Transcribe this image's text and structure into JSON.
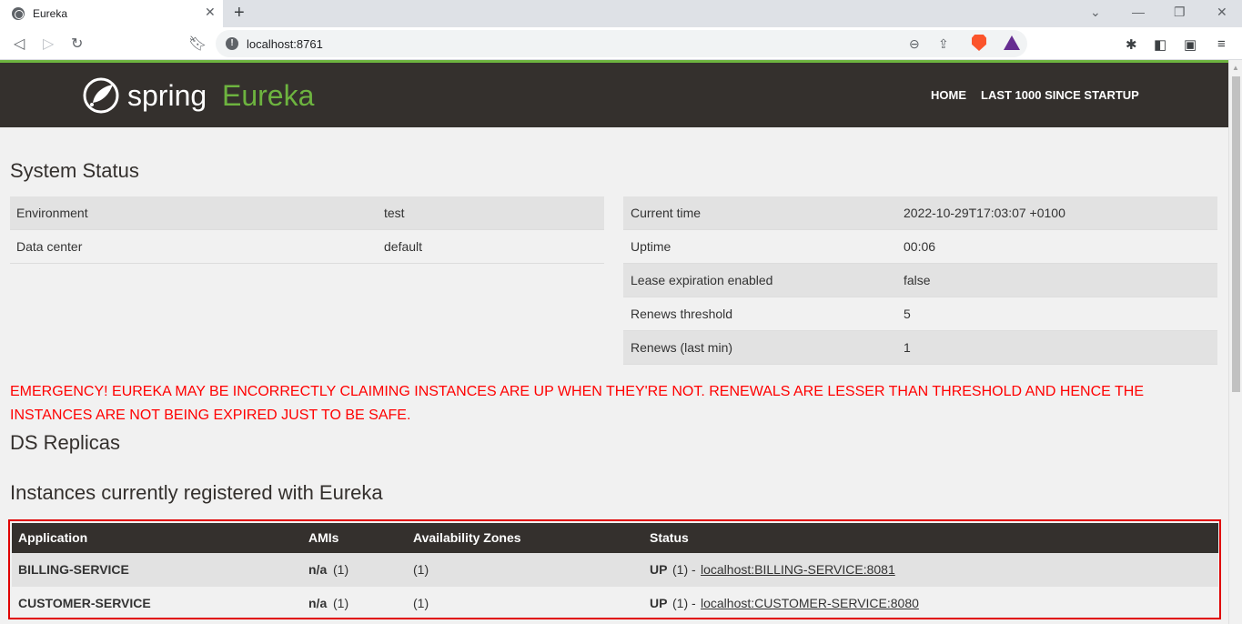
{
  "browser": {
    "tab_title": "Eureka",
    "tab_close": "✕",
    "new_tab": "+",
    "url": "localhost:8761",
    "window_controls": [
      "⌄",
      "—",
      "❐",
      "✕"
    ]
  },
  "navbar": {
    "brand_spring": "spring",
    "brand_eureka": "Eureka",
    "links": [
      "HOME",
      "LAST 1000 SINCE STARTUP"
    ]
  },
  "system_status": {
    "title": "System Status",
    "left": [
      {
        "label": "Environment",
        "value": "test"
      },
      {
        "label": "Data center",
        "value": "default"
      }
    ],
    "right": [
      {
        "label": "Current time",
        "value": "2022-10-29T17:03:07 +0100"
      },
      {
        "label": "Uptime",
        "value": "00:06"
      },
      {
        "label": "Lease expiration enabled",
        "value": "false"
      },
      {
        "label": "Renews threshold",
        "value": "5"
      },
      {
        "label": "Renews (last min)",
        "value": "1"
      }
    ]
  },
  "emergency_text": "EMERGENCY! EUREKA MAY BE INCORRECTLY CLAIMING INSTANCES ARE UP WHEN THEY'RE NOT. RENEWALS ARE LESSER THAN THRESHOLD AND HENCE THE INSTANCES ARE NOT BEING EXPIRED JUST TO BE SAFE.",
  "ds_replicas_title": "DS Replicas",
  "instances": {
    "title": "Instances currently registered with Eureka",
    "headers": [
      "Application",
      "AMIs",
      "Availability Zones",
      "Status"
    ],
    "rows": [
      {
        "application": "BILLING-SERVICE",
        "ami": "n/a",
        "ami_count": "(1)",
        "zones": "(1)",
        "status": "UP",
        "status_count": "(1) -",
        "link": "localhost:BILLING-SERVICE:8081"
      },
      {
        "application": "CUSTOMER-SERVICE",
        "ami": "n/a",
        "ami_count": "(1)",
        "zones": "(1)",
        "status": "UP",
        "status_count": "(1) -",
        "link": "localhost:CUSTOMER-SERVICE:8080"
      }
    ]
  },
  "colors": {
    "spring_green": "#6db33f",
    "navbar_bg": "#34302d",
    "emergency_red": "#ff0000"
  }
}
